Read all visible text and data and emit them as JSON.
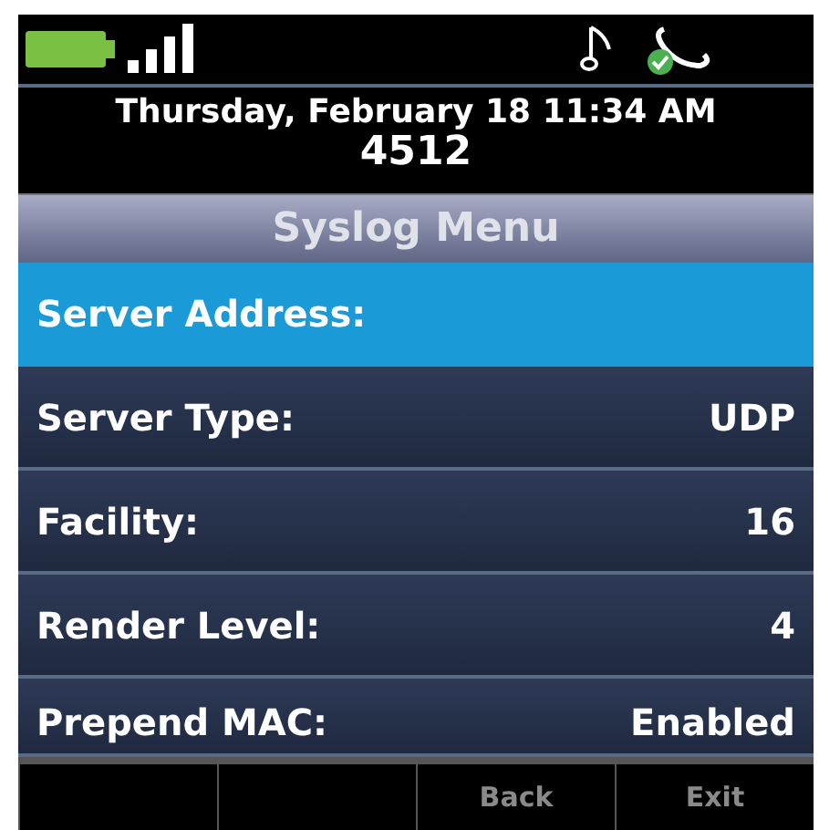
{
  "status_bar": {
    "date_time": "Thursday, February 18 11:34 AM",
    "extension": "4512"
  },
  "title": "Syslog Menu",
  "items": [
    {
      "label": "Server Address:",
      "selected": true
    },
    {
      "label": "Server Type:",
      "value": "UDP",
      "selected": false
    },
    {
      "label": "Facility:",
      "value": "16",
      "selected": false
    },
    {
      "label": "Render Level:",
      "value": "4",
      "selected": false
    },
    {
      "label": "Prepend MAC:",
      "value": "Enabled",
      "selected": false
    }
  ],
  "softkeys": [
    {
      "kind": "blank"
    },
    {
      "kind": "blank"
    },
    {
      "kind": "label",
      "label": "Back"
    },
    {
      "kind": "label",
      "label": "Exit"
    }
  ]
}
